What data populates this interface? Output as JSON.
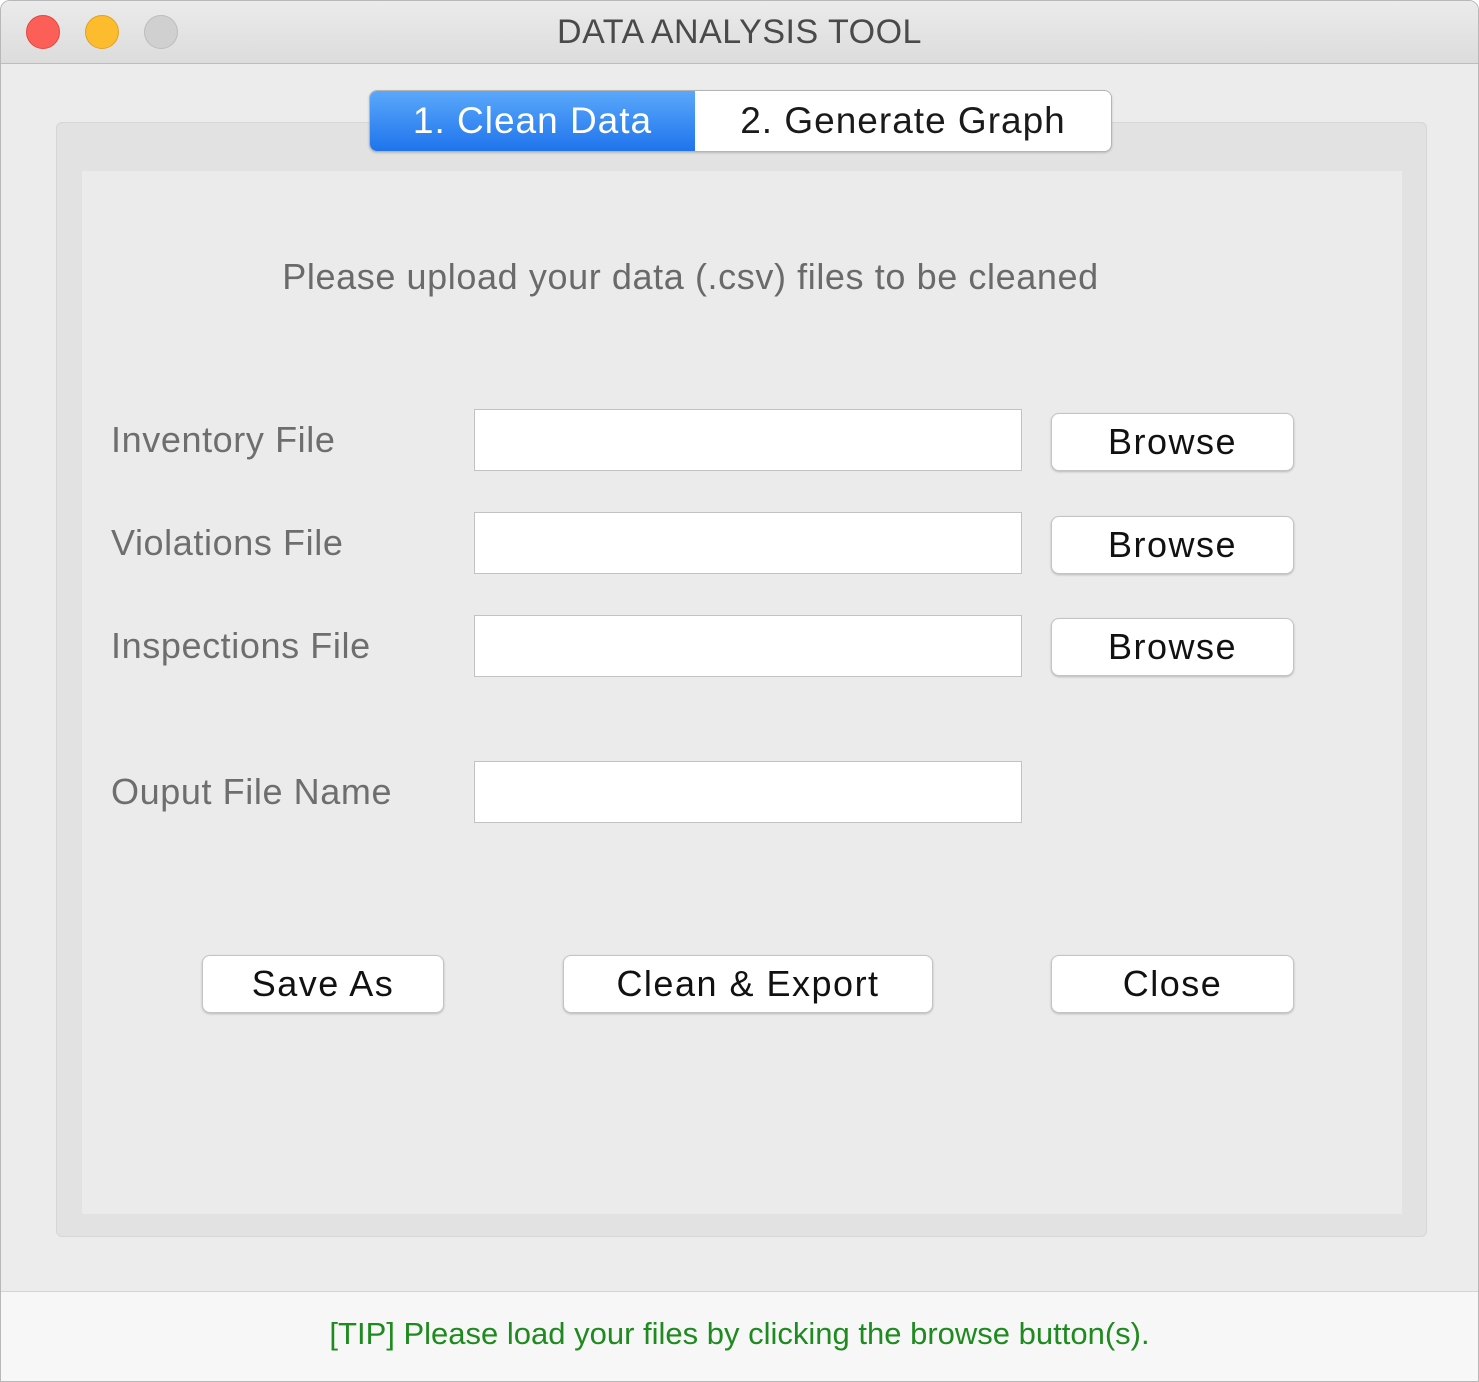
{
  "window": {
    "title": "DATA ANALYSIS TOOL"
  },
  "tabs": [
    {
      "label": "1. Clean Data",
      "selected": true
    },
    {
      "label": "2. Generate Graph",
      "selected": false
    }
  ],
  "main": {
    "instruction": "Please upload your data (.csv) files to be cleaned",
    "inventory": {
      "label": "Inventory File",
      "value": "",
      "button": "Browse"
    },
    "violations": {
      "label": "Violations File",
      "value": "",
      "button": "Browse"
    },
    "inspections": {
      "label": "Inspections File",
      "value": "",
      "button": "Browse"
    },
    "output": {
      "label": "Ouput File Name",
      "value": ""
    },
    "actions": {
      "save_as": "Save As",
      "clean_export": "Clean & Export",
      "close": "Close"
    }
  },
  "status": {
    "tip": "[TIP] Please load your files by clicking the browse button(s)."
  },
  "colors": {
    "tab_active": "#1f74ec",
    "tip_text": "#1f8a1f",
    "close_light": "#fc5f57",
    "minimize_light": "#fdbb2e"
  }
}
